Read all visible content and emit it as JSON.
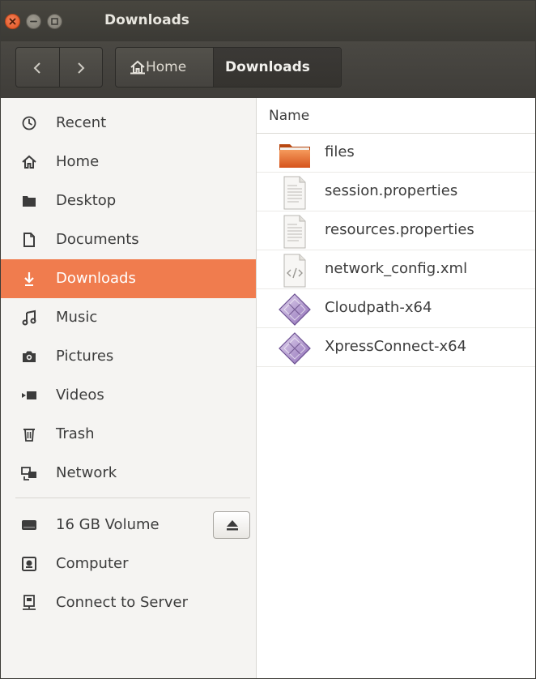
{
  "window": {
    "title": "Downloads"
  },
  "breadcrumb": {
    "home_label": "Home",
    "current_label": "Downloads"
  },
  "sidebar": {
    "items": [
      {
        "label": "Recent",
        "icon": "clock-icon"
      },
      {
        "label": "Home",
        "icon": "home-icon"
      },
      {
        "label": "Desktop",
        "icon": "desktop-folder-icon"
      },
      {
        "label": "Documents",
        "icon": "document-icon"
      },
      {
        "label": "Downloads",
        "icon": "download-arrow-icon",
        "active": true
      },
      {
        "label": "Music",
        "icon": "music-note-icon"
      },
      {
        "label": "Pictures",
        "icon": "camera-icon"
      },
      {
        "label": "Videos",
        "icon": "video-camera-icon"
      },
      {
        "label": "Trash",
        "icon": "trash-icon"
      },
      {
        "label": "Network",
        "icon": "network-icon"
      }
    ],
    "devices": [
      {
        "label": "16 GB Volume",
        "icon": "drive-icon",
        "ejectable": true
      },
      {
        "label": "Computer",
        "icon": "computer-icon"
      },
      {
        "label": "Connect to Server",
        "icon": "server-icon"
      }
    ]
  },
  "list": {
    "column_name": "Name",
    "files": [
      {
        "name": "files",
        "type": "folder-icon"
      },
      {
        "name": "session.properties",
        "type": "text-file-icon"
      },
      {
        "name": "resources.properties",
        "type": "text-file-icon"
      },
      {
        "name": "network_config.xml",
        "type": "xml-file-icon"
      },
      {
        "name": "Cloudpath-x64",
        "type": "executable-icon"
      },
      {
        "name": "XpressConnect-x64",
        "type": "executable-icon"
      }
    ]
  },
  "colors": {
    "accent": "#f07c4e",
    "titlebar": "#3c3b37",
    "sidebar_bg": "#f5f4f2"
  }
}
